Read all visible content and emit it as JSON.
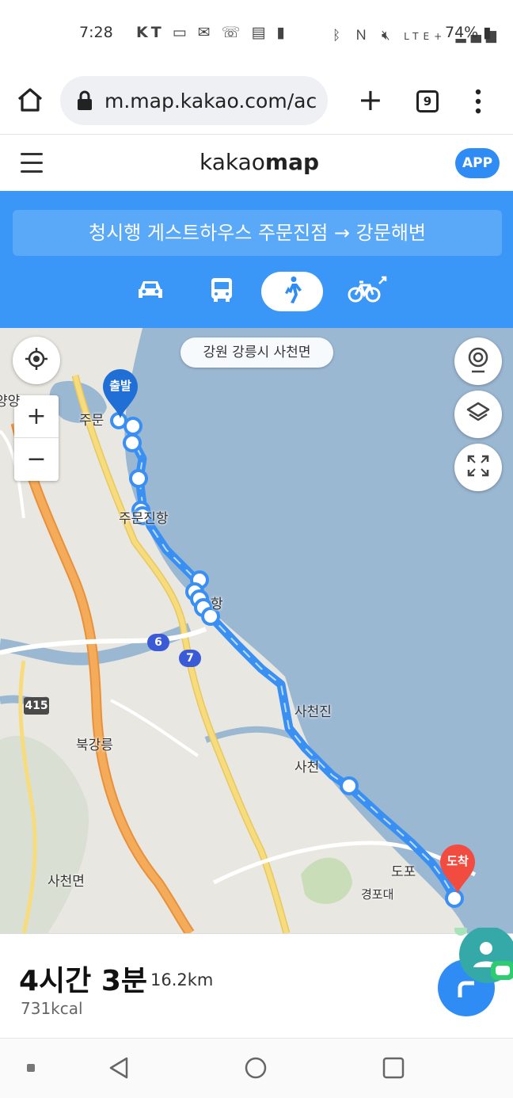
{
  "status_bar": {
    "time": "7:28",
    "carrier": "KT",
    "network": "LTE+",
    "battery": "74%"
  },
  "browser": {
    "url": "m.map.kakao.com/ac",
    "tab_count": "9"
  },
  "header": {
    "logo_light": "kakao",
    "logo_bold": "map",
    "app_button": "APP"
  },
  "route": {
    "title": "청시행 게스트하우스 주문진점 → 강문해변",
    "modes": [
      "car",
      "bus",
      "walk",
      "bike"
    ],
    "active_mode": "walk"
  },
  "map": {
    "region": "강원 강릉시 사천면",
    "start_label": "출발",
    "end_label": "도착",
    "place_labels": [
      "주문",
      "양양",
      "주문진항",
      "항",
      "북강릉",
      "사천진",
      "사천",
      "사천면",
      "도포",
      "경포대"
    ],
    "road_numbers": [
      "6",
      "7",
      "415"
    ],
    "colors": {
      "route": "#3a8ff2",
      "sea": "#9bb8d3",
      "land": "#e9e7e1",
      "highway": "#f2a24a",
      "road": "#f6d47a"
    }
  },
  "summary": {
    "duration": "4시간 3분",
    "distance": "16.2km",
    "calories": "731kcal"
  }
}
